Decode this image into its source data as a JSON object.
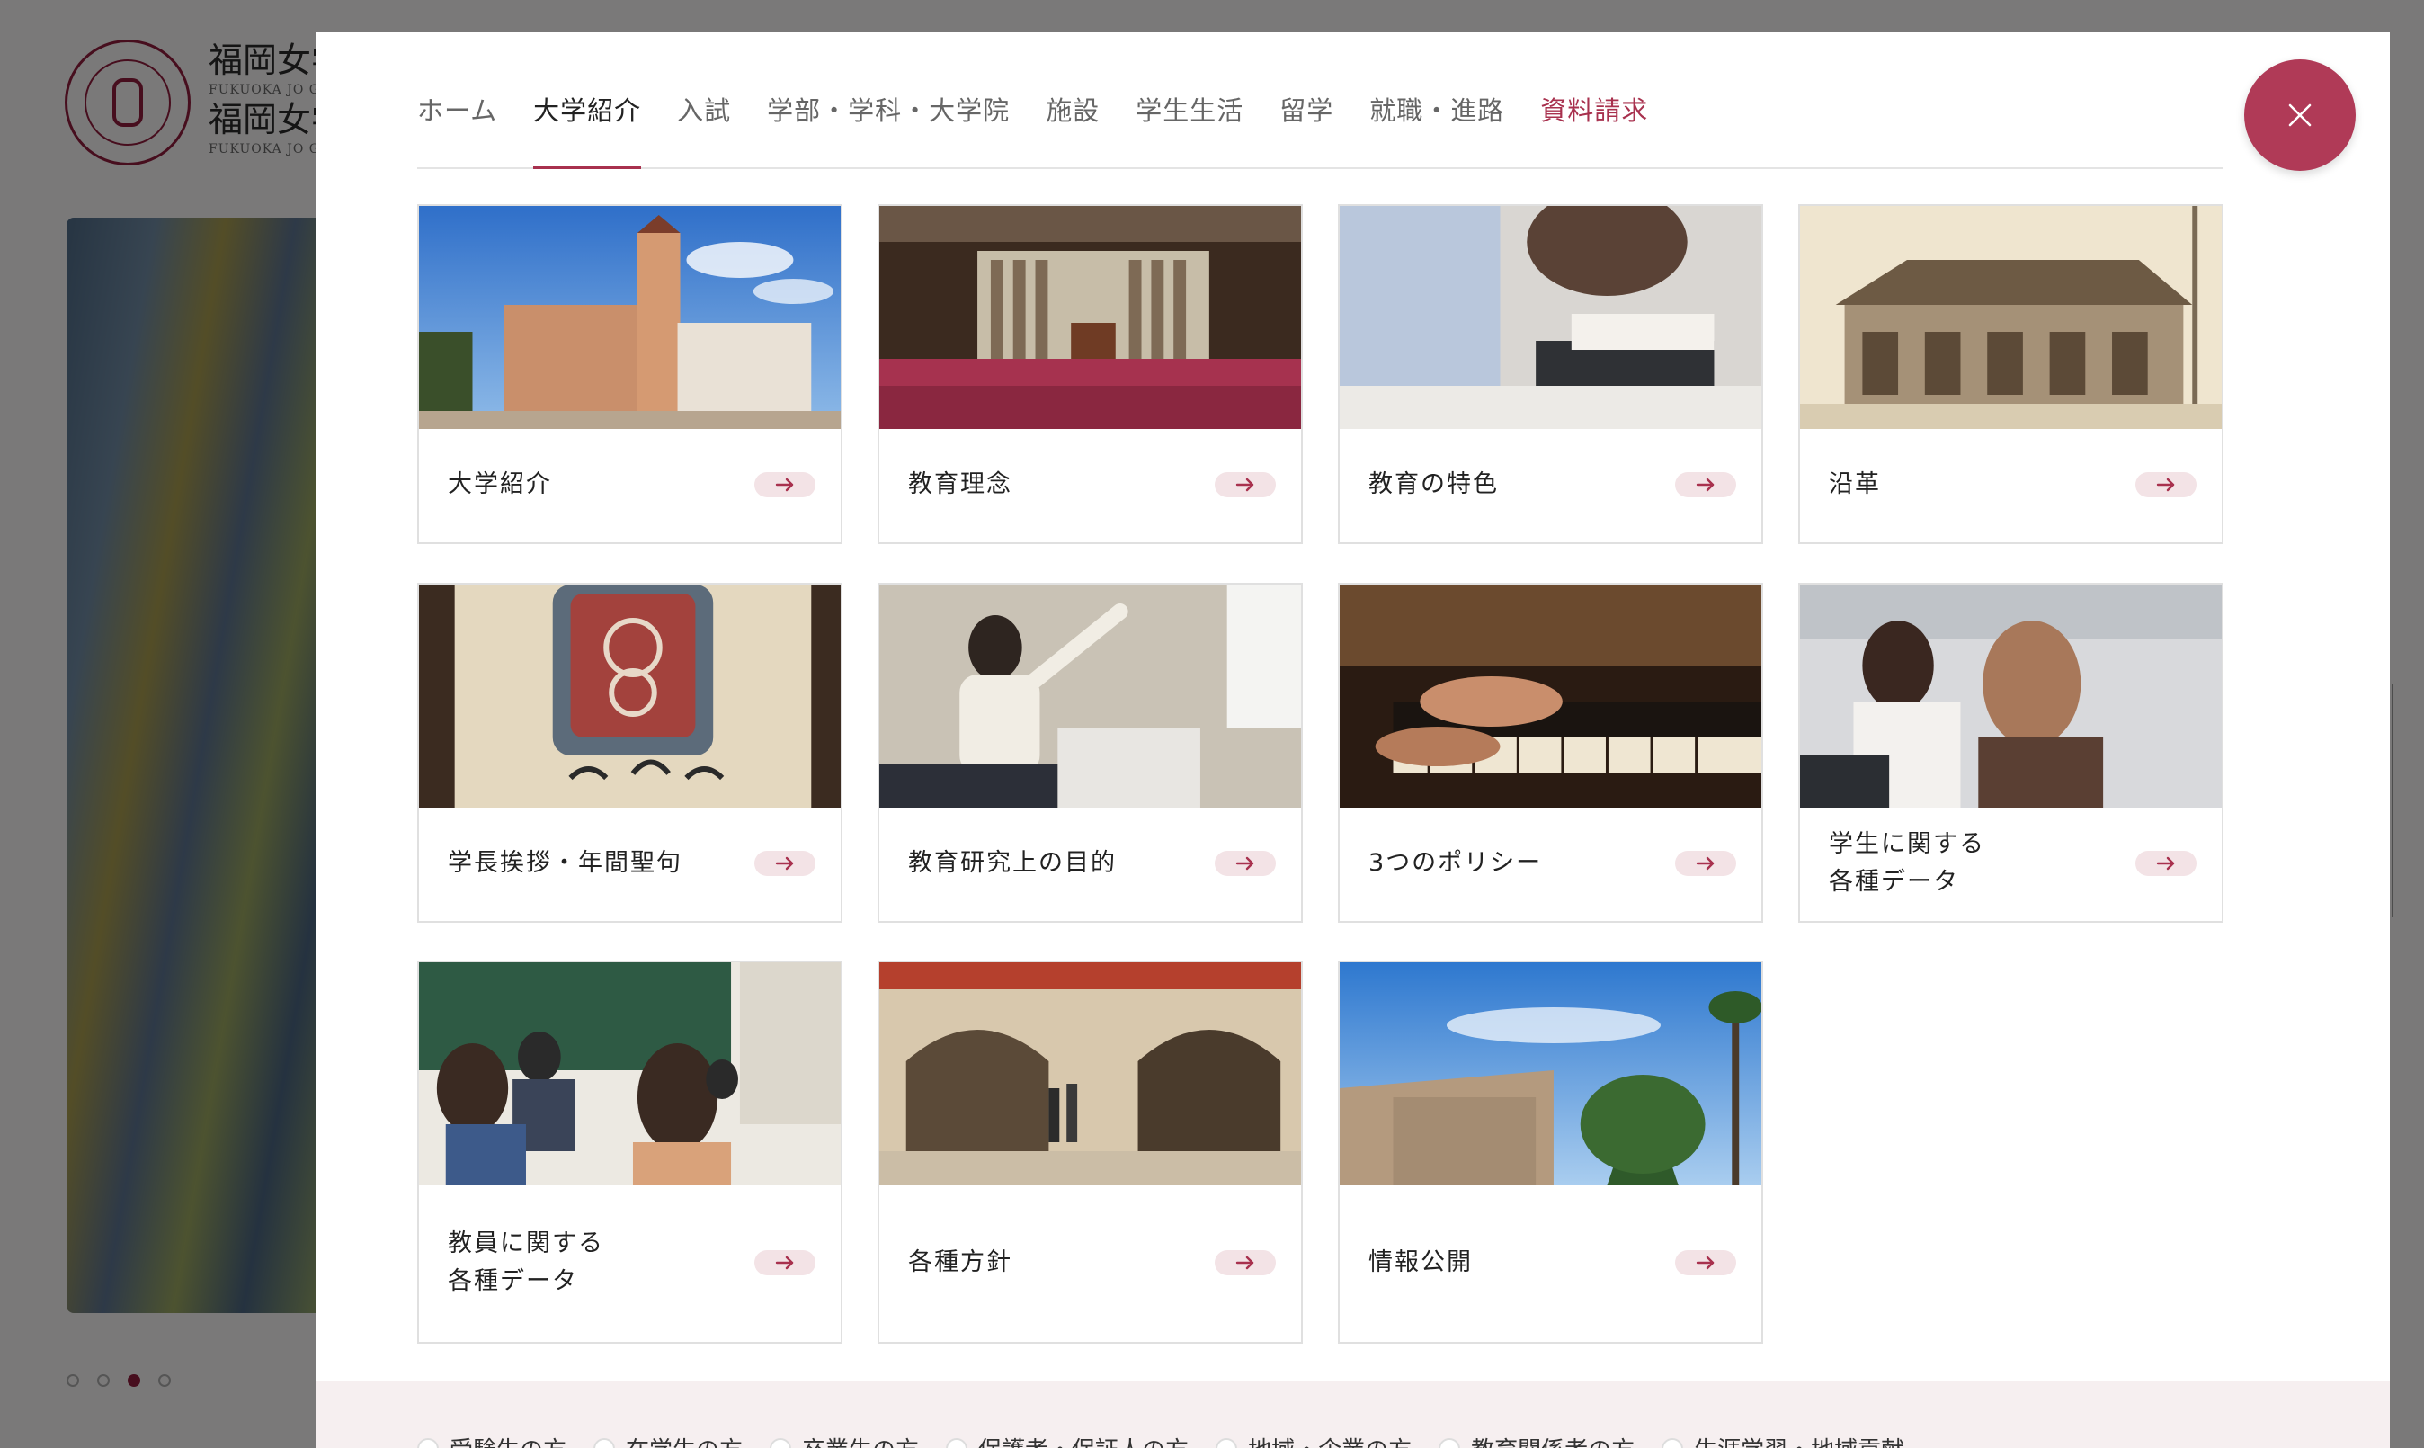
{
  "background": {
    "brand_title": "福岡女学院",
    "brand_sub": "FUKUOKA JO GAKUIN",
    "brand_title_2": "福岡女学院大学",
    "brand_sub_2": "FUKUOKA JO GAKUIN UNIVERSITY"
  },
  "menu": {
    "tabs": [
      {
        "label": "ホーム",
        "state": "normal"
      },
      {
        "label": "大学紹介",
        "state": "active"
      },
      {
        "label": "入試",
        "state": "normal"
      },
      {
        "label": "学部・学科・大学院",
        "state": "normal"
      },
      {
        "label": "施設",
        "state": "normal"
      },
      {
        "label": "学生生活",
        "state": "normal"
      },
      {
        "label": "留学",
        "state": "normal"
      },
      {
        "label": "就職・進路",
        "state": "normal"
      },
      {
        "label": "資料請求",
        "state": "accent"
      }
    ],
    "close_icon": "close-icon",
    "cards": [
      {
        "label": "大学紹介",
        "image": "campus-building-photo"
      },
      {
        "label": "教育理念",
        "image": "chapel-organ-hall-photo"
      },
      {
        "label": "教育の特色",
        "image": "students-laptop-photo"
      },
      {
        "label": "沿革",
        "image": "historic-building-photo"
      },
      {
        "label": "学長挨拶・年間聖句",
        "image": "school-crest-plaque-photo"
      },
      {
        "label": "教育研究上の目的",
        "image": "student-presentation-photo"
      },
      {
        "label": "3つのポリシー",
        "image": "organ-keyboard-photo"
      },
      {
        "label": "学生に関する\n各種データ",
        "image": "students-classroom-photo"
      },
      {
        "label": "教員に関する\n各種データ",
        "image": "teacher-students-photo"
      },
      {
        "label": "各種方針",
        "image": "campus-arches-photo"
      },
      {
        "label": "情報公開",
        "image": "campus-sky-trees-photo"
      }
    ],
    "arrow_icon": "arrow-right-icon"
  },
  "audience": {
    "items": [
      "受験生の方",
      "在学生の方",
      "卒業生の方",
      "保護者・保証人の方",
      "地域・企業の方",
      "教育関係者の方",
      "生涯学習・地域貢献"
    ]
  },
  "colors": {
    "accent": "#a8314e",
    "close_button": "#b03a57",
    "arrow_pill": "#f3e3e6",
    "audience_bg": "#f6eff0"
  }
}
